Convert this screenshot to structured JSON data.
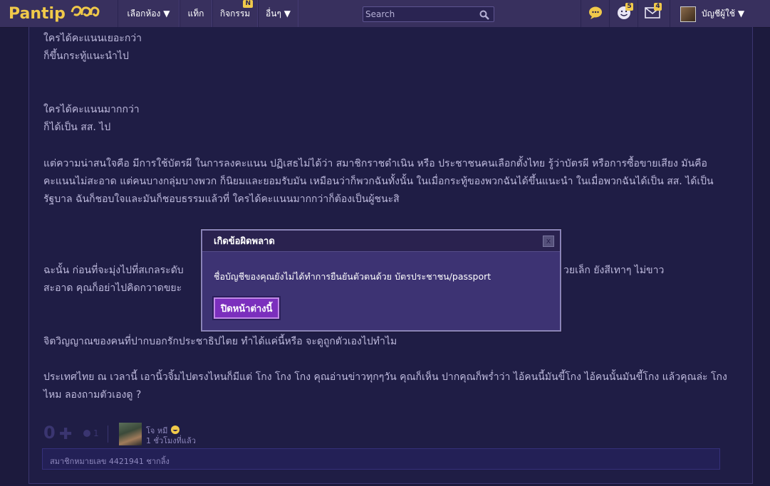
{
  "header": {
    "logo_text": "Pantip",
    "nav": [
      {
        "label": "เลือกห้อง ▼"
      },
      {
        "label": "แท็ก"
      },
      {
        "label": "กิจกรรม",
        "badge": "N"
      },
      {
        "label": "อื่นๆ ▼"
      }
    ],
    "search_placeholder": "Search",
    "icons": [
      {
        "name": "chat-icon"
      },
      {
        "name": "notification-icon",
        "count": "5"
      },
      {
        "name": "mail-icon",
        "count": "4"
      }
    ],
    "account_label": "บัญชีผู้ใช้ ▼"
  },
  "post": {
    "paragraphs": [
      "ใครได้คะแนนเยอะกว่า",
      "ก็ขึ้นกระทู้แนะนำไป",
      "ใครได้คะแนนมากกว่า",
      "ก็ได้เป็น สส. ไป",
      "แต่ความน่าสนใจคือ   มีการใช้บัตรผี ในการลงคะแนน     ปฏิเสธไม่ได้ว่า  สมาชิกราชดำเนิน  หรือ ประชาชนคนเลือกตั้งไทย     รู้ว่าบัตรผี  หรือการซื้อขายเสียง   มันคือคะแนนไม่สะอาด   แต่คนบางกลุ่มบางพวก   ก็นิยมและยอมรับมัน         เหมือนว่าก็พวกฉันทั้งนั้น   ในเมื่อกระทู้ของพวกฉันได้ขึ้นแนะนำ   ในเมื่อพวกฉันได้เป็น สส.  ได้เป็นรัฐบาล   ฉันก็ชอบใจและมันก็ชอบธรรมแล้วที่   ใครได้คะแนนมากกว่าก็ต้องเป็นผู้ชนะสิ",
      "ฉะนั้น   ก่อนที่จะมุ่งไปที่สเกลระดับ",
      "วยเล็ก  ยังสีเทาๆ ไม่ขาว",
      "สะอาด      คุณก็อย่าไปคิดกวาดขยะ",
      "จิตวิญญาณของคนที่ปากบอกรักประชาธิปไตย  ทำได้แค่นี้หรือ    จะดูถูกตัวเองไปทำไม",
      "ประเทศไทย ณ เวลานี้  เอานิ้วจิ้มไปตรงไหนก็มีแต่ โกง โกง โกง     คุณอ่านข่าวทุกๆวัน  คุณก็เห็น   ปากคุณก็พร่ำว่า   ไอ้คนนี้มันขี้โกง   ไอ้คนนั้นมันขี้โกง        แล้วคุณล่ะ  โกงไหม   ลองถามตัวเองดู ?"
    ],
    "score": "0",
    "emotion_count": "1",
    "author_name": "โจ หมี",
    "time_ago": "1 ชั่วโมงที่แล้ว",
    "member_info": "สมาชิกหมายเลข 4421941 ชากลิ้ง"
  },
  "modal": {
    "title": "เกิดข้อผิดพลาด",
    "close": "x",
    "message": "ชื่อบัญชีของคุณยังไม่ได้ทำการยืนยันตัวตนด้วย บัตรประชาชน/passport",
    "button": "ปิดหน้าต่างนี้"
  }
}
